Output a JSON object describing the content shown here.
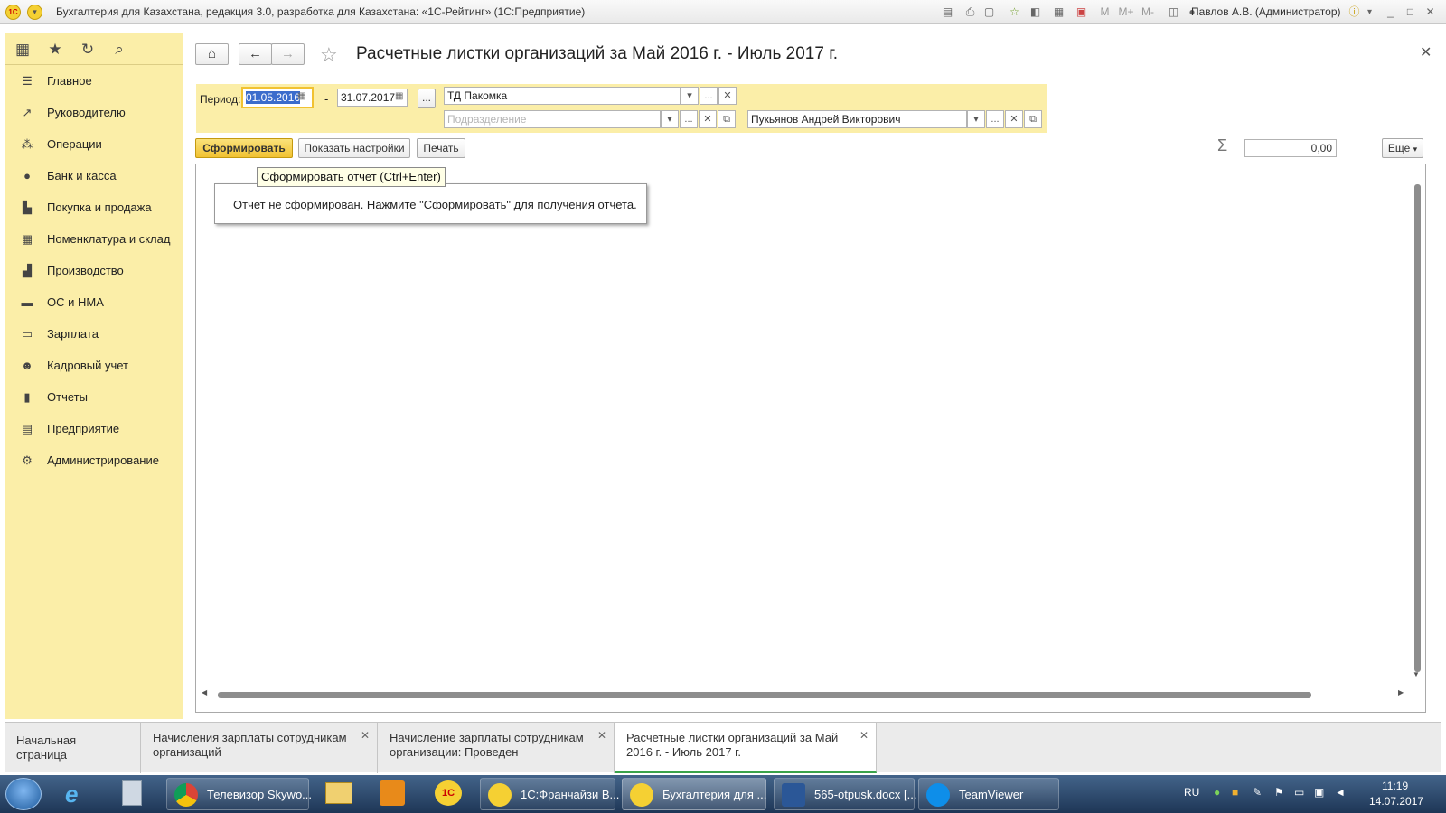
{
  "window": {
    "title": "Бухгалтерия для Казахстана, редакция 3.0, разработка для Казахстана: «1С-Рейтинг» (1С:Предприятие)",
    "user": "Павлов А.В. (Администратор)",
    "tool_m": "M",
    "tool_mplus": "M+",
    "tool_mminus": "M-"
  },
  "sidebar": {
    "items": [
      {
        "label": "Главное",
        "icon": "menu-icon"
      },
      {
        "label": "Руководителю",
        "icon": "trend-icon"
      },
      {
        "label": "Операции",
        "icon": "operations-icon"
      },
      {
        "label": "Банк и касса",
        "icon": "bank-icon"
      },
      {
        "label": "Покупка и продажа",
        "icon": "cart-icon"
      },
      {
        "label": "Номенклатура и склад",
        "icon": "warehouse-icon"
      },
      {
        "label": "Производство",
        "icon": "production-icon"
      },
      {
        "label": "ОС и НМА",
        "icon": "truck-icon"
      },
      {
        "label": "Зарплата",
        "icon": "salary-icon"
      },
      {
        "label": "Кадровый учет",
        "icon": "people-icon"
      },
      {
        "label": "Отчеты",
        "icon": "chart-icon"
      },
      {
        "label": "Предприятие",
        "icon": "enterprise-icon"
      },
      {
        "label": "Администрирование",
        "icon": "gear-icon"
      }
    ]
  },
  "form": {
    "title": "Расчетные листки организаций  за Май 2016 г. - Июль 2017 г.",
    "period_label": "Период:",
    "period_from": "01.05.2016",
    "period_dash": "-",
    "period_to": "31.07.2017",
    "dots": "...",
    "organization": "ТД Пакомка",
    "department_placeholder": "Подразделение",
    "employee": "Пукьянов Андрей Викторович",
    "generate_label": "Сформировать",
    "settings_label": "Показать настройки",
    "print_label": "Печать",
    "sum_value": "0,00",
    "more_label": "Еще",
    "tooltip": "Сформировать отчет (Ctrl+Enter)",
    "message": "Отчет не сформирован. Нажмите \"Сформировать\" для получения отчета."
  },
  "tabs": [
    {
      "label": "Начальная страница"
    },
    {
      "label": "Начисления зарплаты сотрудникам организаций"
    },
    {
      "label": "Начисление зарплаты сотрудникам организации: Проведен"
    },
    {
      "label": "Расчетные листки организаций  за Май 2016 г. - Июль 2017 г."
    }
  ],
  "taskbar": {
    "items": [
      {
        "label": "Телевизор Skywo..."
      },
      {
        "label": "1С:Франчайзи В..."
      },
      {
        "label": "Бухгалтерия для ..."
      },
      {
        "label": "565-otpusk.docx [..."
      },
      {
        "label": "TeamViewer"
      }
    ],
    "lang": "RU",
    "time": "11:19",
    "date": "14.07.2017"
  },
  "colors": {
    "accent": "#fbeea8",
    "button_primary": "#f5d033",
    "active_tab_line": "#3aa34a"
  }
}
